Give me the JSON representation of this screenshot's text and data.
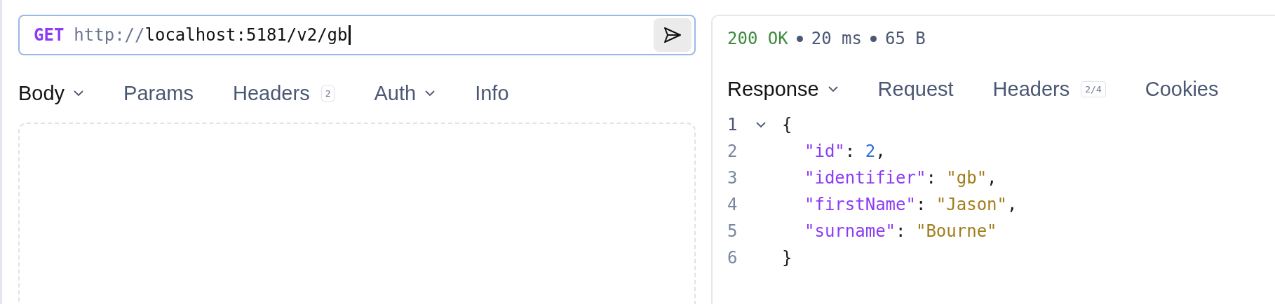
{
  "request": {
    "method": "GET",
    "url_scheme": "http://",
    "url_rest": "localhost:5181/v2/gb",
    "tabs": [
      {
        "label": "Body",
        "selected": true,
        "dropdown": true
      },
      {
        "label": "Params",
        "selected": false,
        "dropdown": false
      },
      {
        "label": "Headers",
        "selected": false,
        "dropdown": false,
        "badge": "2"
      },
      {
        "label": "Auth",
        "selected": false,
        "dropdown": true
      },
      {
        "label": "Info",
        "selected": false,
        "dropdown": false
      }
    ]
  },
  "response": {
    "status": "200 OK",
    "time": "20 ms",
    "size": "65 B",
    "tabs": [
      {
        "label": "Response",
        "selected": true,
        "dropdown": true
      },
      {
        "label": "Request",
        "selected": false,
        "dropdown": false
      },
      {
        "label": "Headers",
        "selected": false,
        "dropdown": false,
        "badge": "2/4"
      },
      {
        "label": "Cookies",
        "selected": false,
        "dropdown": false
      }
    ],
    "lines": [
      {
        "number": "1",
        "foldable": true,
        "indent": false,
        "tokens": [
          {
            "kind": "punct",
            "text": "{"
          }
        ]
      },
      {
        "number": "2",
        "foldable": false,
        "indent": true,
        "tokens": [
          {
            "kind": "key",
            "text": "\"id\""
          },
          {
            "kind": "punct",
            "text": ": "
          },
          {
            "kind": "number",
            "text": "2"
          },
          {
            "kind": "punct",
            "text": ","
          }
        ]
      },
      {
        "number": "3",
        "foldable": false,
        "indent": true,
        "tokens": [
          {
            "kind": "key",
            "text": "\"identifier\""
          },
          {
            "kind": "punct",
            "text": ": "
          },
          {
            "kind": "string",
            "text": "\"gb\""
          },
          {
            "kind": "punct",
            "text": ","
          }
        ]
      },
      {
        "number": "4",
        "foldable": false,
        "indent": true,
        "tokens": [
          {
            "kind": "key",
            "text": "\"firstName\""
          },
          {
            "kind": "punct",
            "text": ": "
          },
          {
            "kind": "string",
            "text": "\"Jason\""
          },
          {
            "kind": "punct",
            "text": ","
          }
        ]
      },
      {
        "number": "5",
        "foldable": false,
        "indent": true,
        "tokens": [
          {
            "kind": "key",
            "text": "\"surname\""
          },
          {
            "kind": "punct",
            "text": ": "
          },
          {
            "kind": "string",
            "text": "\"Bourne\""
          }
        ]
      },
      {
        "number": "6",
        "foldable": false,
        "indent": false,
        "tokens": [
          {
            "kind": "punct",
            "text": "}"
          }
        ]
      }
    ]
  }
}
